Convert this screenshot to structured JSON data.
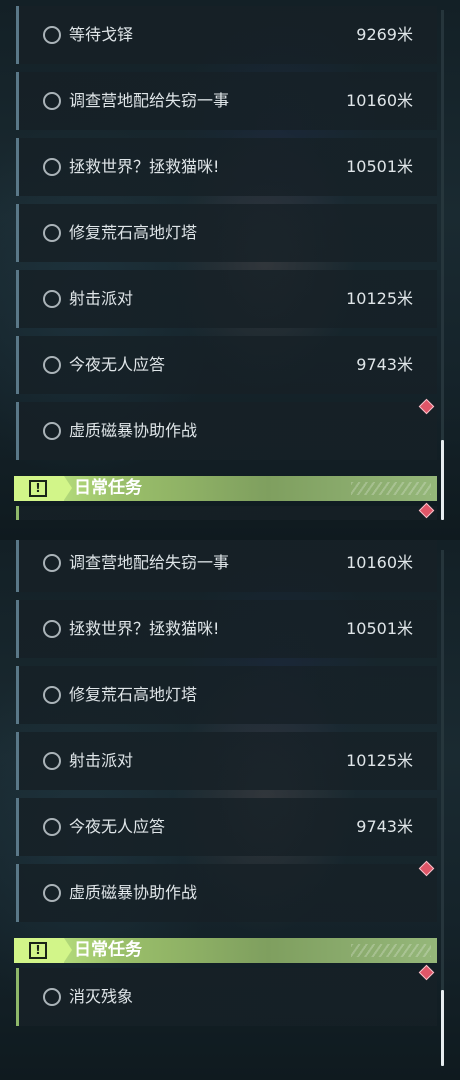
{
  "top": {
    "rows": [
      {
        "name": "等待戈铎",
        "dist": "9269米"
      },
      {
        "name": "调查营地配给失窃一事",
        "dist": "10160米"
      },
      {
        "name": "拯救世界？拯救猫咪!",
        "dist": "10501米"
      },
      {
        "name": "修复荒石高地灯塔",
        "dist": ""
      },
      {
        "name": "射击派对",
        "dist": "10125米"
      },
      {
        "name": "今夜无人应答",
        "dist": "9743米"
      },
      {
        "name": "虚质磁暴协助作战",
        "dist": ""
      }
    ],
    "section_title": "日常任务",
    "section_icon": "exclamation-icon"
  },
  "bottom": {
    "rows": [
      {
        "name": "调查营地配给失窃一事",
        "dist": "10160米"
      },
      {
        "name": "拯救世界？拯救猫咪!",
        "dist": "10501米"
      },
      {
        "name": "修复荒石高地灯塔",
        "dist": ""
      },
      {
        "name": "射击派对",
        "dist": "10125米"
      },
      {
        "name": "今夜无人应答",
        "dist": "9743米"
      },
      {
        "name": "虚质磁暴协助作战",
        "dist": ""
      }
    ],
    "section_title": "日常任务",
    "section_icon": "exclamation-icon",
    "daily_rows": [
      {
        "name": "消灭残象",
        "dist": ""
      }
    ]
  },
  "colors": {
    "accent_green": "#c6ef88",
    "row_border": "#5a7888",
    "alert_red": "#e05668"
  }
}
